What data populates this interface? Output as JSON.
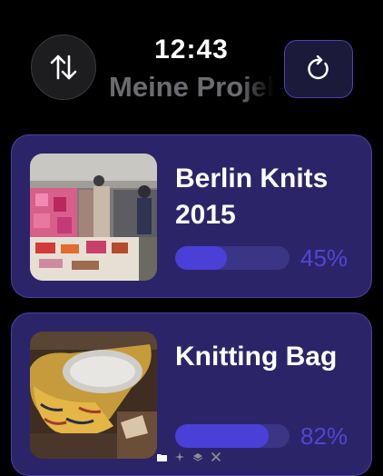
{
  "header": {
    "time": "12:43",
    "title": "Meine Projekte"
  },
  "projects": [
    {
      "title": "Berlin Knits 2015",
      "progress": 0.45,
      "progress_label": "45%"
    },
    {
      "title": "Knitting Bag",
      "progress": 0.82,
      "progress_label": "82%"
    }
  ],
  "colors": {
    "card_bg": "#2c2468",
    "progress_fill": "#4a40d8",
    "progress_text": "#4f46d4",
    "title_gray": "#6b6b70"
  },
  "icons": {
    "sort": "sort-arrows-icon",
    "refresh": "refresh-icon",
    "page_indicators": [
      "folder-icon",
      "sparkle-icon",
      "layers-icon",
      "tools-icon"
    ]
  }
}
